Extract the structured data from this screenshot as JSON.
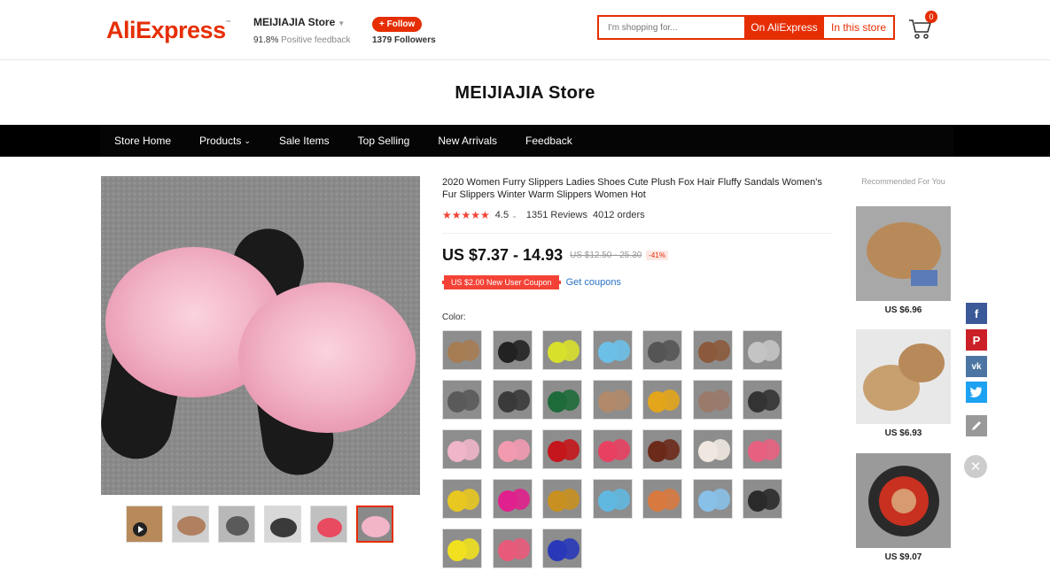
{
  "header": {
    "logo_part1": "Ali",
    "logo_part2": "Express",
    "logo_tm": "™",
    "store_name": "MEIJIAJIA Store",
    "feedback_pct": "91.8%",
    "feedback_label": "Positive feedback",
    "follow_label": "+ Follow",
    "followers": "1379 Followers",
    "search_placeholder": "I'm shopping for...",
    "search_all_label": "On AliExpress",
    "search_store_label": "In this store",
    "cart_count": "0"
  },
  "store_title": "MEIJIAJIA Store",
  "nav": {
    "items": [
      "Store Home",
      "Products",
      "Sale Items",
      "Top Selling",
      "New Arrivals",
      "Feedback"
    ]
  },
  "product": {
    "title": "2020 Women Furry Slippers Ladies Shoes Cute Plush Fox Hair Fluffy Sandals Women's Fur Slippers Winter Warm Slippers Women Hot",
    "rating": "4.5",
    "reviews": "1351 Reviews",
    "orders": "4012 orders",
    "price": "US $7.37 - 14.93",
    "original_price": "US $12.50 - 25.30",
    "discount": "-41%",
    "coupon": "US $2.00 New User Coupon",
    "get_coupons": "Get coupons",
    "color_label": "Color:",
    "main_image_color": "#f2b7c9",
    "thumbs": [
      "video-thumb",
      "thumb-2",
      "thumb-3",
      "thumb-4",
      "thumb-5",
      "thumb-6"
    ],
    "swatch_colors": [
      "#a67c52",
      "#222222",
      "#d8e02c",
      "#6cc0e8",
      "#555555",
      "#8b5a3c",
      "#c4c4c4",
      "#5a5a5a",
      "#3a3a3a",
      "#1e6b3a",
      "#b08a6a",
      "#e2a51b",
      "#9a7a6a",
      "#333333",
      "#f0b5c8",
      "#f29ab0",
      "#c4161c",
      "#e84060",
      "#6b2a1a",
      "#f0e8e0",
      "#e86080",
      "#e8c820",
      "#e0208c",
      "#c89020",
      "#60b8e0",
      "#d87a40",
      "#88c0e8",
      "#2a2a2a",
      "#f0e020",
      "#e85a7a",
      "#2838b8"
    ]
  },
  "recommended": {
    "title": "Recommended For You",
    "items": [
      {
        "price": "US $6.96",
        "color": "#b88a5a"
      },
      {
        "price": "US $6.93",
        "color": "#c8a070"
      },
      {
        "price": "US $9.07",
        "color": "#a83020"
      }
    ]
  },
  "social": {
    "facebook_color": "#3b5998",
    "pinterest_color": "#cb2027",
    "vk_color": "#4c75a3",
    "twitter_color": "#1da1f2",
    "edit_color": "#999999"
  }
}
